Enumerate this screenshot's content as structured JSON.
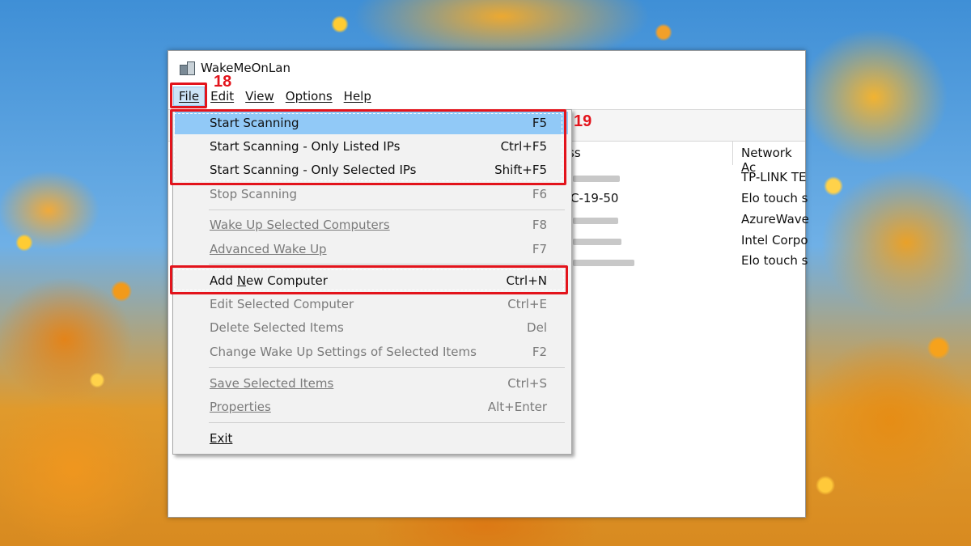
{
  "window": {
    "title": "WakeMeOnLan"
  },
  "menubar": {
    "items": [
      {
        "label": "File"
      },
      {
        "label": "Edit"
      },
      {
        "label": "View"
      },
      {
        "label": "Options"
      },
      {
        "label": "Help"
      }
    ]
  },
  "list": {
    "partial_header_1": "ss",
    "partial_header_2": "Network Ac",
    "rows": [
      {
        "mac_partial": "",
        "adapter": "TP-LINK TE"
      },
      {
        "mac_partial": "C-19-50",
        "adapter": "Elo touch s"
      },
      {
        "mac_partial": "",
        "adapter": "AzureWave"
      },
      {
        "mac_partial": "",
        "adapter": "Intel Corpo"
      },
      {
        "mac_partial": "",
        "adapter": "Elo touch s"
      }
    ]
  },
  "file_menu": {
    "start_scanning": {
      "label": "Start Scanning",
      "key": "F5"
    },
    "start_listed": {
      "label": "Start Scanning - Only Listed IPs",
      "key": "Ctrl+F5"
    },
    "start_selected": {
      "label": "Start Scanning - Only Selected IPs",
      "key": "Shift+F5"
    },
    "stop_scanning": {
      "label": "Stop Scanning",
      "key": "F6"
    },
    "wake_selected": {
      "label": "Wake Up Selected Computers",
      "key": "F8"
    },
    "advanced_wake": {
      "label": "Advanced Wake Up",
      "key": "F7"
    },
    "add_new": {
      "label_pre": "Add ",
      "label_u": "N",
      "label_post": "ew Computer",
      "key": "Ctrl+N"
    },
    "edit_selected": {
      "label": "Edit Selected Computer",
      "key": "Ctrl+E"
    },
    "delete_selected": {
      "label": "Delete Selected Items",
      "key": "Del"
    },
    "change_wake": {
      "label": "Change Wake Up Settings of Selected Items",
      "key": "F2"
    },
    "save_selected": {
      "label": "Save Selected Items",
      "key": "Ctrl+S"
    },
    "properties": {
      "label": "Properties",
      "key": "Alt+Enter"
    },
    "exit": {
      "label": "Exit",
      "key": ""
    }
  },
  "annotations": {
    "file_badge": "18",
    "menu_badge": "19"
  },
  "colors": {
    "callout": "#e3141c",
    "hover": "#91c9f7"
  }
}
